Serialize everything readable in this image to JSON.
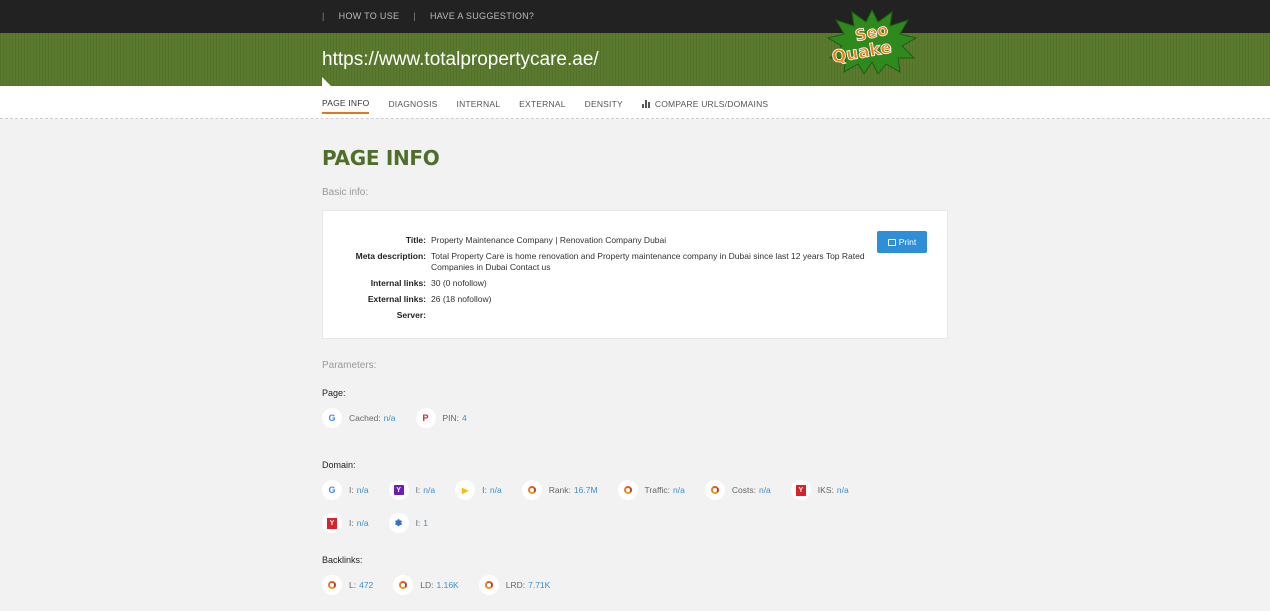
{
  "topnav": {
    "items": [
      "HOW TO USE",
      "HAVE A SUGGESTION?"
    ]
  },
  "header": {
    "url": "https://www.totalpropertycare.ae/",
    "logo_text_1": "Seo",
    "logo_text_2": "Quake"
  },
  "tabs": [
    {
      "label": "PAGE INFO",
      "active": true
    },
    {
      "label": "DIAGNOSIS"
    },
    {
      "label": "INTERNAL"
    },
    {
      "label": "EXTERNAL"
    },
    {
      "label": "DENSITY"
    },
    {
      "label": "COMPARE URLS/DOMAINS"
    }
  ],
  "page": {
    "title": "PAGE INFO",
    "basic_label": "Basic info:",
    "print_label": "Print",
    "info": [
      {
        "key": "Title:",
        "value": "Property Maintenance Company | Renovation Company Dubai"
      },
      {
        "key": "Meta description:",
        "value": "Total Property Care is home renovation and Property maintenance company in Dubai since last 12 years Top Rated Companies in Dubai Contact us"
      },
      {
        "key": "Internal links:",
        "value": "30 (0 nofollow)"
      },
      {
        "key": "External links:",
        "value": "26 (18 nofollow)"
      },
      {
        "key": "Server:",
        "value": ""
      }
    ],
    "params_label": "Parameters:",
    "groups": {
      "page": {
        "label": "Page:",
        "metrics": [
          {
            "icon": "google-icon",
            "label": "Cached:",
            "value": "n/a"
          },
          {
            "icon": "pinterest-icon",
            "label": "PIN:",
            "value": "4"
          }
        ]
      },
      "domain": {
        "label": "Domain:",
        "metrics": [
          {
            "icon": "google-icon",
            "label": "I:",
            "value": "n/a"
          },
          {
            "icon": "yahoo-icon",
            "label": "I:",
            "value": "n/a"
          },
          {
            "icon": "bing-icon",
            "label": "I:",
            "value": "n/a"
          },
          {
            "icon": "semrush-icon",
            "label": "Rank:",
            "value": "16.7M"
          },
          {
            "icon": "semrush-icon",
            "label": "Traffic:",
            "value": "n/a"
          },
          {
            "icon": "semrush-icon",
            "label": "Costs:",
            "value": "n/a"
          },
          {
            "icon": "yandex-icon",
            "label": "IKS:",
            "value": "n/a"
          },
          {
            "icon": "yandex-icon",
            "label": "I:",
            "value": "n/a"
          },
          {
            "icon": "baidu-icon",
            "label": "I:",
            "value": "1"
          }
        ]
      },
      "backlinks": {
        "label": "Backlinks:",
        "metrics": [
          {
            "icon": "semrush-icon",
            "label": "L:",
            "value": "472"
          },
          {
            "icon": "semrush-icon",
            "label": "LD:",
            "value": "1.16K"
          },
          {
            "icon": "semrush-icon",
            "label": "LRD:",
            "value": "7.71K"
          }
        ]
      }
    }
  }
}
